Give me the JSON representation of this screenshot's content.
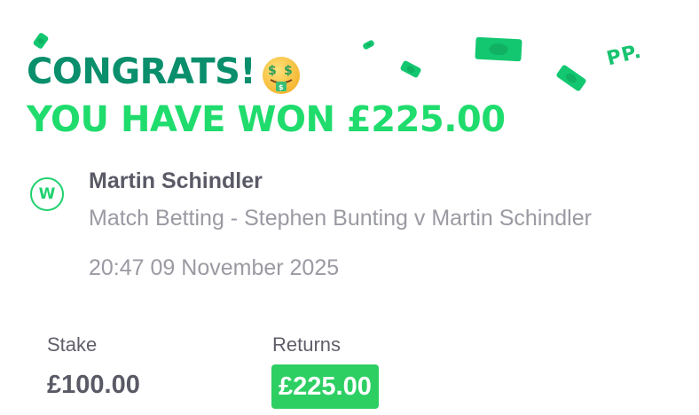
{
  "colors": {
    "headline_primary": "#0a8f6c",
    "headline_accent": "#1fdc6d",
    "confetti": "#12c770",
    "returns_badge": "#2dcf63"
  },
  "banner": {
    "line1": "CONGRATS!",
    "line2": "YOU HAVE WON £225.00",
    "emoji": "money-mouth-face-icon",
    "watermark": "PP."
  },
  "bet": {
    "result_badge": "W",
    "selection": "Martin Schindler",
    "market": "Match Betting - Stephen Bunting v Martin Schindler",
    "datetime": "20:47 09 November 2025"
  },
  "summary": {
    "stake_label": "Stake",
    "stake_value": "£100.00",
    "returns_label": "Returns",
    "returns_value": "£225.00"
  }
}
